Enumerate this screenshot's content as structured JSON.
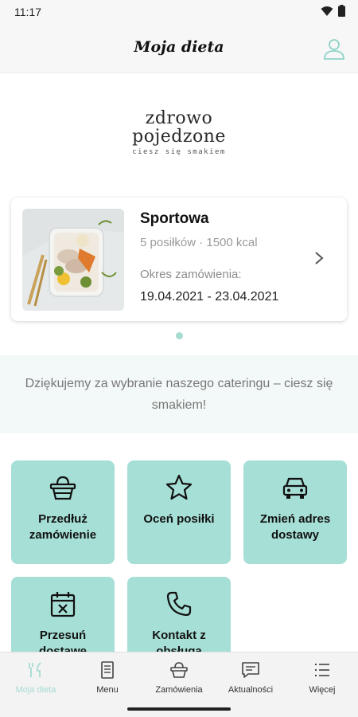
{
  "status_bar": {
    "time": "11:17"
  },
  "header": {
    "title": "Moja dieta"
  },
  "logo": {
    "line1": "zdrowo",
    "line2": "pojedzone",
    "tagline": "ciesz się smakiem"
  },
  "diet_card": {
    "name": "Sportowa",
    "meta": "5 posiłków · 1500 kcal",
    "period_label": "Okres zamówienia:",
    "period": "19.04.2021 - 23.04.2021"
  },
  "thanks": {
    "text": "Dziękujemy za wybranie naszego cateringu – ciesz się smakiem!"
  },
  "tiles": [
    {
      "label": "Przedłuż zamówienie",
      "icon": "basket-icon"
    },
    {
      "label": "Oceń posiłki",
      "icon": "star-icon"
    },
    {
      "label": "Zmień adres dostawy",
      "icon": "car-icon"
    },
    {
      "label": "Przesuń dostawę",
      "icon": "calendar-icon"
    },
    {
      "label": "Kontakt z obsługą",
      "icon": "phone-icon"
    }
  ],
  "bottom_nav": [
    {
      "label": "Moja dieta",
      "icon": "fork-knife-icon",
      "active": true
    },
    {
      "label": "Menu",
      "icon": "menu-book-icon"
    },
    {
      "label": "Zamówienia",
      "icon": "basket-icon"
    },
    {
      "label": "Aktualności",
      "icon": "chat-icon"
    },
    {
      "label": "Więcej",
      "icon": "list-icon"
    }
  ],
  "colors": {
    "accent": "#a6dfd6",
    "header_bg": "#f7f7f7",
    "text": "#111111",
    "muted": "#9a9a9a"
  }
}
